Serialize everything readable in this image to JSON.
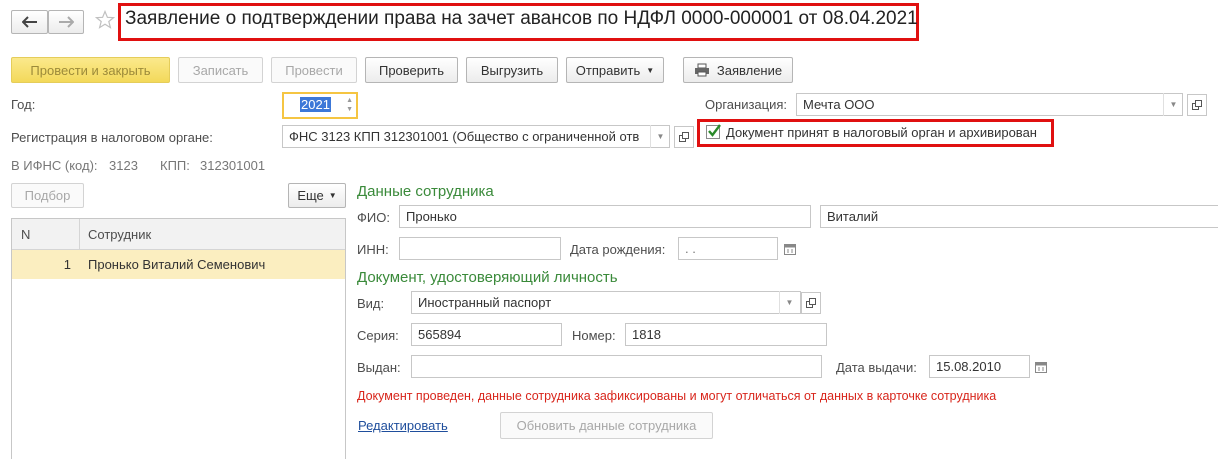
{
  "header": {
    "back_icon": "arrow-left-icon",
    "forward_icon": "arrow-right-icon",
    "star_icon": "star-icon",
    "title": "Заявление о подтверждении права на зачет авансов по НДФЛ 0000-000001 от 08.04.2021"
  },
  "toolbar": {
    "post_close": "Провести и закрыть",
    "save": "Записать",
    "post": "Провести",
    "check": "Проверить",
    "export": "Выгрузить",
    "send": "Отправить",
    "statement": "Заявление",
    "printer_icon": "printer-icon"
  },
  "form": {
    "year_label": "Год:",
    "year_value": "2021",
    "org_label": "Организация:",
    "org_value": "Мечта ООО",
    "reg_label": "Регистрация в налоговом органе:",
    "reg_value": "ФНС 3123 КПП 312301001 (Общество с ограниченной отв",
    "archived_label": "Документ принят в налоговый орган и архивирован",
    "archived_checked": true,
    "ifns_label": "В ИФНС (код):",
    "ifns_code": "3123",
    "kpp_label": "КПП:",
    "kpp_value": "312301001"
  },
  "table": {
    "select_button": "Подбор",
    "more_button": "Еще",
    "col_n": "N",
    "col_employee": "Сотрудник",
    "rows": [
      {
        "n": "1",
        "employee": "Пронько Виталий Семенович"
      }
    ]
  },
  "employee": {
    "section_title": "Данные сотрудника",
    "fio_label": "ФИО:",
    "last_name": "Пронько",
    "first_name": "Виталий",
    "inn_label": "ИНН:",
    "inn_value": "",
    "birth_label": "Дата рождения:",
    "birth_value": " .  .",
    "calendar_icon": "calendar-icon"
  },
  "identity": {
    "section_title": "Документ, удостоверяющий личность",
    "type_label": "Вид:",
    "type_value": "Иностранный паспорт",
    "series_label": "Серия:",
    "series_value": "565894",
    "number_label": "Номер:",
    "number_value": "1818",
    "issued_label": "Выдан:",
    "issued_value": "",
    "issue_date_label": "Дата выдачи:",
    "issue_date_value": "15.08.2010"
  },
  "notice": "Документ проведен, данные сотрудника зафиксированы и могут отличаться от данных в карточке сотрудника",
  "edit_link": "Редактировать",
  "refresh_button": "Обновить данные сотрудника",
  "colors": {
    "highlight_red": "#e01010",
    "section_green": "#3a8a3a",
    "notice_red": "#d8261c",
    "selected_row": "#fbeec0",
    "primary_button": "#f3d95a"
  }
}
